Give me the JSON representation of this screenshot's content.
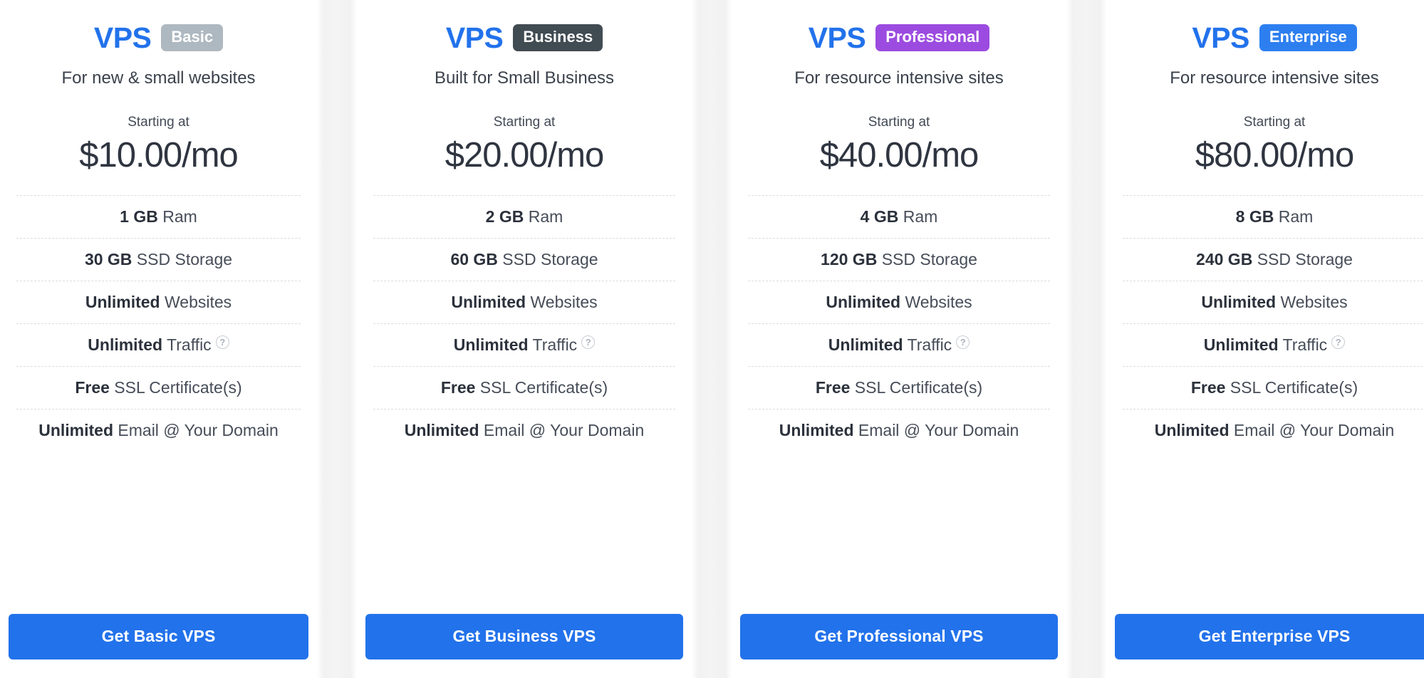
{
  "brand_label": "VPS",
  "colors": {
    "brand_blue": "#2272EB",
    "cta_blue": "#2272EB",
    "badge_basic": "#AEB8C0",
    "badge_business": "#414B52",
    "badge_professional": "#9C4BE0",
    "badge_enterprise": "#2D7FF0",
    "text_dark": "#2B313B",
    "text_body": "#434A55",
    "divider": "#D9DCE0",
    "gutter": "#F3F3F3"
  },
  "starting_at_label": "Starting at",
  "help_icon_glyph": "?",
  "plans": [
    {
      "badge": "Basic",
      "badge_color": "#AEB8C0",
      "tagline": "For new & small websites",
      "price": "$10.00/mo",
      "features": [
        {
          "strong": "1 GB",
          "text": " Ram",
          "help": false
        },
        {
          "strong": "30 GB",
          "text": " SSD Storage",
          "help": false
        },
        {
          "strong": "Unlimited",
          "text": " Websites",
          "help": false
        },
        {
          "strong": "Unlimited",
          "text": " Traffic",
          "help": true
        },
        {
          "strong": "Free",
          "text": " SSL Certificate(s)",
          "help": false
        },
        {
          "strong": "Unlimited",
          "text": " Email @ Your Domain",
          "help": false
        }
      ],
      "cta": "Get Basic VPS"
    },
    {
      "badge": "Business",
      "badge_color": "#414B52",
      "tagline": "Built for Small Business",
      "price": "$20.00/mo",
      "features": [
        {
          "strong": "2 GB",
          "text": " Ram",
          "help": false
        },
        {
          "strong": "60 GB",
          "text": " SSD Storage",
          "help": false
        },
        {
          "strong": "Unlimited",
          "text": " Websites",
          "help": false
        },
        {
          "strong": "Unlimited",
          "text": " Traffic",
          "help": true
        },
        {
          "strong": "Free",
          "text": " SSL Certificate(s)",
          "help": false
        },
        {
          "strong": "Unlimited",
          "text": " Email @ Your Domain",
          "help": false
        }
      ],
      "cta": "Get Business VPS"
    },
    {
      "badge": "Professional",
      "badge_color": "#9C4BE0",
      "tagline": "For resource intensive sites",
      "price": "$40.00/mo",
      "features": [
        {
          "strong": "4 GB",
          "text": " Ram",
          "help": false
        },
        {
          "strong": "120 GB",
          "text": " SSD Storage",
          "help": false
        },
        {
          "strong": "Unlimited",
          "text": " Websites",
          "help": false
        },
        {
          "strong": "Unlimited",
          "text": " Traffic",
          "help": true
        },
        {
          "strong": "Free",
          "text": " SSL Certificate(s)",
          "help": false
        },
        {
          "strong": "Unlimited",
          "text": " Email @ Your Domain",
          "help": false
        }
      ],
      "cta": "Get Professional VPS"
    },
    {
      "badge": "Enterprise",
      "badge_color": "#2D7FF0",
      "tagline": "For resource intensive sites",
      "price": "$80.00/mo",
      "features": [
        {
          "strong": "8 GB",
          "text": " Ram",
          "help": false
        },
        {
          "strong": "240 GB",
          "text": " SSD Storage",
          "help": false
        },
        {
          "strong": "Unlimited",
          "text": " Websites",
          "help": false
        },
        {
          "strong": "Unlimited",
          "text": " Traffic",
          "help": true
        },
        {
          "strong": "Free",
          "text": " SSL Certificate(s)",
          "help": false
        },
        {
          "strong": "Unlimited",
          "text": " Email @ Your Domain",
          "help": false
        }
      ],
      "cta": "Get Enterprise VPS"
    }
  ]
}
